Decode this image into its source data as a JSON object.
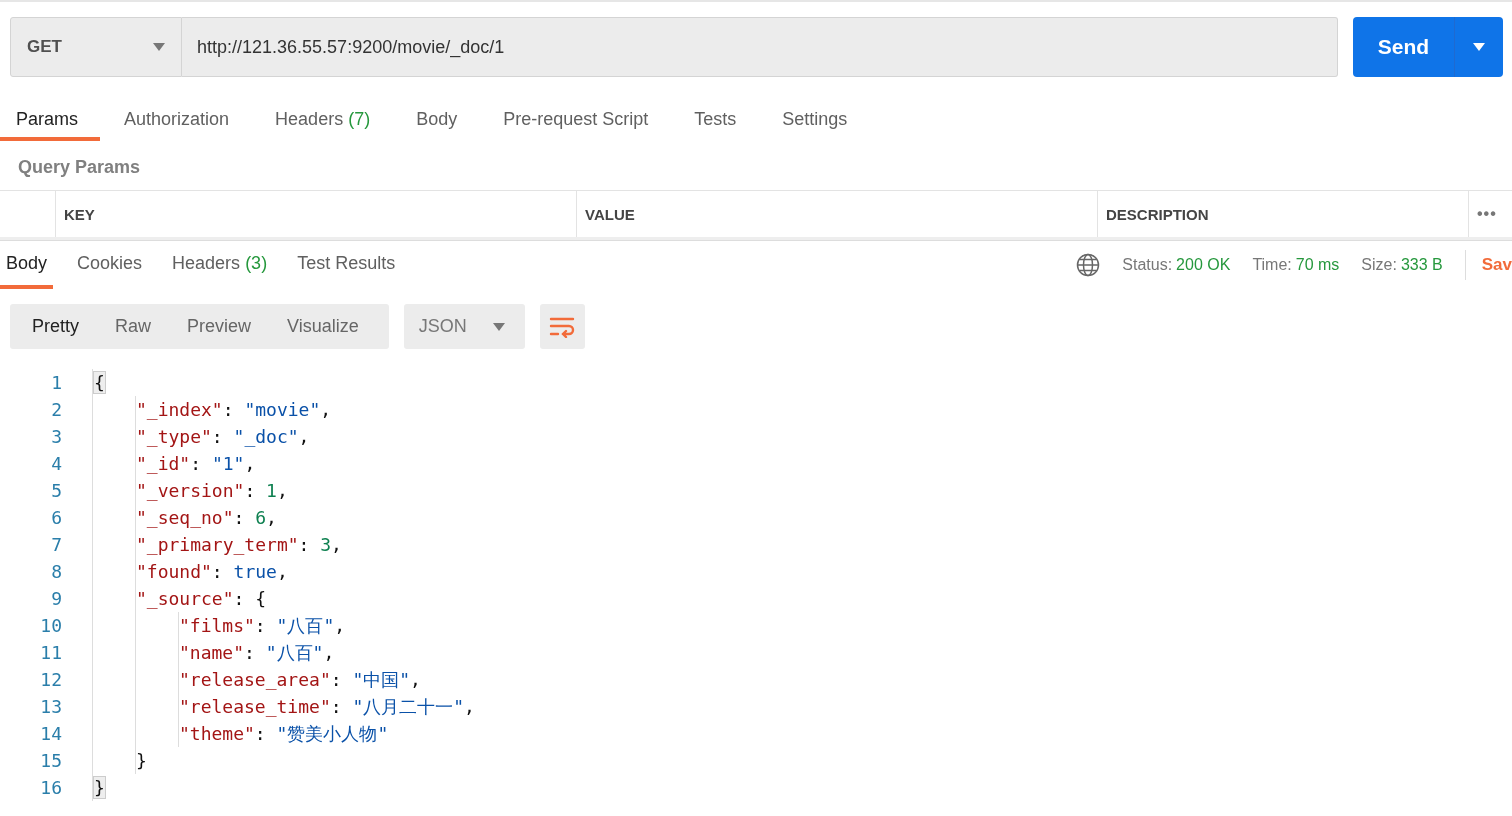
{
  "request": {
    "method": "GET",
    "url": "http://121.36.55.57:9200/movie/_doc/1",
    "send_label": "Send"
  },
  "request_tabs": [
    {
      "label": "Params",
      "selected": true
    },
    {
      "label": "Authorization",
      "selected": false
    },
    {
      "label": "Headers",
      "count": "(7)",
      "selected": false
    },
    {
      "label": "Body",
      "selected": false
    },
    {
      "label": "Pre-request Script",
      "selected": false
    },
    {
      "label": "Tests",
      "selected": false
    },
    {
      "label": "Settings",
      "selected": false
    }
  ],
  "query_params": {
    "title": "Query Params",
    "columns": [
      "KEY",
      "VALUE",
      "DESCRIPTION"
    ],
    "more": "•••"
  },
  "response_tabs": [
    {
      "label": "Body",
      "selected": true
    },
    {
      "label": "Cookies",
      "selected": false
    },
    {
      "label": "Headers",
      "count": "(3)",
      "selected": false
    },
    {
      "label": "Test Results",
      "selected": false
    }
  ],
  "response_status": [
    {
      "label": "Status:",
      "value": "200 OK"
    },
    {
      "label": "Time:",
      "value": "70 ms"
    },
    {
      "label": "Size:",
      "value": "333 B"
    }
  ],
  "save_label": "Sav",
  "view_modes": [
    {
      "label": "Pretty",
      "selected": true
    },
    {
      "label": "Raw",
      "selected": false
    },
    {
      "label": "Preview",
      "selected": false
    },
    {
      "label": "Visualize",
      "selected": false
    }
  ],
  "language": "JSON",
  "code": [
    {
      "number": "1",
      "tokens": [
        {
          "kind": "brace",
          "text": "{"
        }
      ],
      "children": [
        {
          "number": "2",
          "tokens": [
            {
              "kind": "key",
              "text": "\"_index\""
            },
            {
              "kind": "punct",
              "text": ": "
            },
            {
              "kind": "string",
              "text": "\"movie\""
            },
            {
              "kind": "punct",
              "text": ","
            }
          ]
        },
        {
          "number": "3",
          "tokens": [
            {
              "kind": "key",
              "text": "\"_type\""
            },
            {
              "kind": "punct",
              "text": ": "
            },
            {
              "kind": "string",
              "text": "\"_doc\""
            },
            {
              "kind": "punct",
              "text": ","
            }
          ]
        },
        {
          "number": "4",
          "tokens": [
            {
              "kind": "key",
              "text": "\"_id\""
            },
            {
              "kind": "punct",
              "text": ": "
            },
            {
              "kind": "string",
              "text": "\"1\""
            },
            {
              "kind": "punct",
              "text": ","
            }
          ]
        },
        {
          "number": "5",
          "tokens": [
            {
              "kind": "key",
              "text": "\"_version\""
            },
            {
              "kind": "punct",
              "text": ": "
            },
            {
              "kind": "number",
              "text": "1"
            },
            {
              "kind": "punct",
              "text": ","
            }
          ]
        },
        {
          "number": "6",
          "tokens": [
            {
              "kind": "key",
              "text": "\"_seq_no\""
            },
            {
              "kind": "punct",
              "text": ": "
            },
            {
              "kind": "number",
              "text": "6"
            },
            {
              "kind": "punct",
              "text": ","
            }
          ]
        },
        {
          "number": "7",
          "tokens": [
            {
              "kind": "key",
              "text": "\"_primary_term\""
            },
            {
              "kind": "punct",
              "text": ": "
            },
            {
              "kind": "number",
              "text": "3"
            },
            {
              "kind": "punct",
              "text": ","
            }
          ]
        },
        {
          "number": "8",
          "tokens": [
            {
              "kind": "key",
              "text": "\"found\""
            },
            {
              "kind": "punct",
              "text": ": "
            },
            {
              "kind": "boolean",
              "text": "true"
            },
            {
              "kind": "punct",
              "text": ","
            }
          ]
        },
        {
          "number": "9",
          "tokens": [
            {
              "kind": "key",
              "text": "\"_source\""
            },
            {
              "kind": "punct",
              "text": ": {"
            }
          ],
          "children": [
            {
              "number": "10",
              "tokens": [
                {
                  "kind": "key",
                  "text": "\"films\""
                },
                {
                  "kind": "punct",
                  "text": ": "
                },
                {
                  "kind": "string",
                  "text": "\"八百\""
                },
                {
                  "kind": "punct",
                  "text": ","
                }
              ]
            },
            {
              "number": "11",
              "tokens": [
                {
                  "kind": "key",
                  "text": "\"name\""
                },
                {
                  "kind": "punct",
                  "text": ": "
                },
                {
                  "kind": "string",
                  "text": "\"八百\""
                },
                {
                  "kind": "punct",
                  "text": ","
                }
              ]
            },
            {
              "number": "12",
              "tokens": [
                {
                  "kind": "key",
                  "text": "\"release_area\""
                },
                {
                  "kind": "punct",
                  "text": ": "
                },
                {
                  "kind": "string",
                  "text": "\"中国\""
                },
                {
                  "kind": "punct",
                  "text": ","
                }
              ]
            },
            {
              "number": "13",
              "tokens": [
                {
                  "kind": "key",
                  "text": "\"release_time\""
                },
                {
                  "kind": "punct",
                  "text": ": "
                },
                {
                  "kind": "string",
                  "text": "\"八月二十一\""
                },
                {
                  "kind": "punct",
                  "text": ","
                }
              ]
            },
            {
              "number": "14",
              "tokens": [
                {
                  "kind": "key",
                  "text": "\"theme\""
                },
                {
                  "kind": "punct",
                  "text": ": "
                },
                {
                  "kind": "string",
                  "text": "\"赞美小人物\""
                }
              ]
            }
          ]
        },
        {
          "number": "15",
          "tokens": [
            {
              "kind": "punct",
              "text": "}"
            }
          ]
        }
      ]
    },
    {
      "number": "16",
      "tokens": [
        {
          "kind": "brace",
          "text": "}"
        }
      ]
    }
  ]
}
